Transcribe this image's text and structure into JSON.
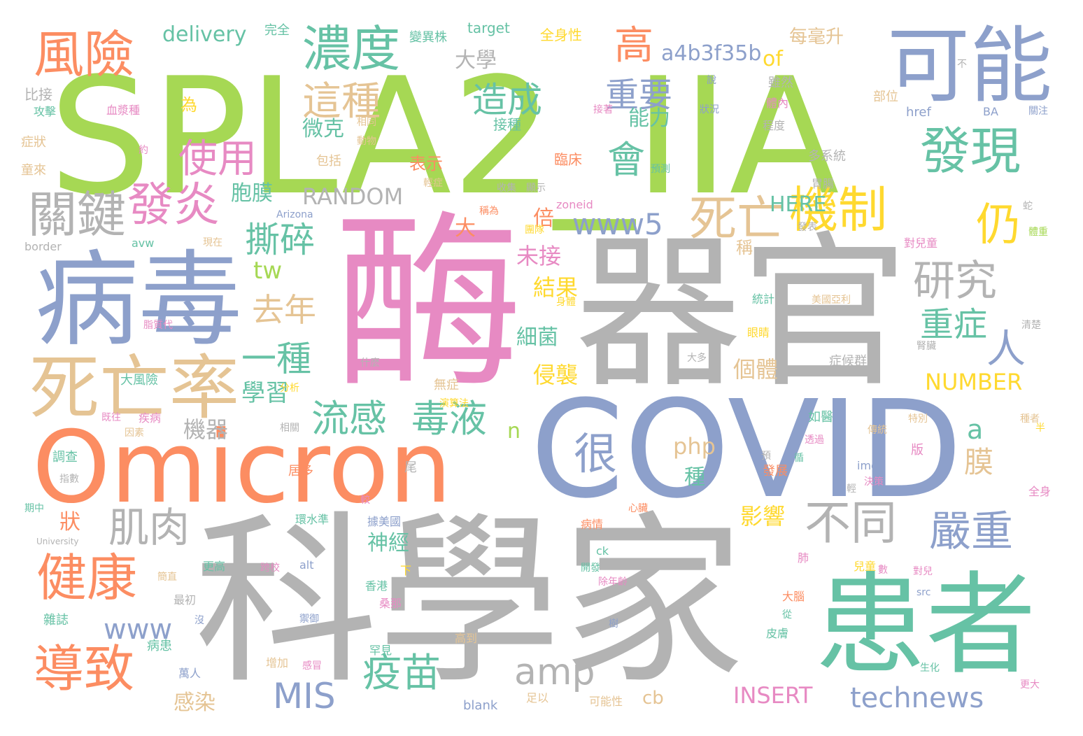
{
  "words": [
    {
      "text": "SPLA2_IIA",
      "color": "#a6d854"
    },
    {
      "text": "酶",
      "color": "#e78ac3"
    },
    {
      "text": "器官",
      "color": "#b3b3b3"
    },
    {
      "text": "COVID",
      "color": "#8da0cb"
    },
    {
      "text": "科學家",
      "color": "#b3b3b3"
    },
    {
      "text": "Omicron",
      "color": "#fc8d62"
    },
    {
      "text": "病毒",
      "color": "#8da0cb"
    },
    {
      "text": "患者",
      "color": "#66c2a5"
    },
    {
      "text": "死亡率",
      "color": "#e5c494"
    },
    {
      "text": "可能",
      "color": "#8da0cb"
    },
    {
      "text": "風險",
      "color": "#fc8d62"
    },
    {
      "text": "濃度",
      "color": "#66c2a5"
    },
    {
      "text": "發現",
      "color": "#66c2a5"
    },
    {
      "text": "關鍵",
      "color": "#b3b3b3"
    },
    {
      "text": "發炎",
      "color": "#e78ac3"
    },
    {
      "text": "死亡",
      "color": "#e5c494"
    },
    {
      "text": "機制",
      "color": "#ffd92f"
    },
    {
      "text": "仍",
      "color": "#ffd92f"
    },
    {
      "text": "健康",
      "color": "#fc8d62"
    },
    {
      "text": "導致",
      "color": "#fc8d62"
    },
    {
      "text": "嚴重",
      "color": "#8da0cb"
    },
    {
      "text": "不同",
      "color": "#b3b3b3"
    },
    {
      "text": "很",
      "color": "#8da0cb"
    },
    {
      "text": "研究",
      "color": "#b3b3b3"
    },
    {
      "text": "人",
      "color": "#8da0cb"
    },
    {
      "text": "會",
      "color": "#66c2a5"
    },
    {
      "text": "這種",
      "color": "#e5c494"
    },
    {
      "text": "使用",
      "color": "#e78ac3"
    },
    {
      "text": "高",
      "color": "#fc8d62"
    },
    {
      "text": "造成",
      "color": "#66c2a5"
    },
    {
      "text": "重要",
      "color": "#8da0cb"
    },
    {
      "text": "重症",
      "color": "#66c2a5"
    },
    {
      "text": "www5",
      "color": "#8da0cb"
    },
    {
      "text": "肌肉",
      "color": "#b3b3b3"
    },
    {
      "text": "撕碎",
      "color": "#66c2a5"
    },
    {
      "text": "流感",
      "color": "#66c2a5"
    },
    {
      "text": "毒液",
      "color": "#66c2a5"
    },
    {
      "text": "疫苗",
      "color": "#66c2a5"
    },
    {
      "text": "一種",
      "color": "#66c2a5"
    },
    {
      "text": "去年",
      "color": "#e5c494"
    },
    {
      "text": "amp",
      "color": "#b3b3b3"
    },
    {
      "text": "technews",
      "color": "#8da0cb"
    },
    {
      "text": "www",
      "color": "#8da0cb"
    },
    {
      "text": "MIS",
      "color": "#8da0cb"
    },
    {
      "text": "a4b3f35b",
      "color": "#8da0cb"
    },
    {
      "text": "delivery",
      "color": "#66c2a5"
    },
    {
      "text": "RANDOM",
      "color": "#b3b3b3"
    },
    {
      "text": "NUMBER",
      "color": "#ffd92f"
    },
    {
      "text": "INSERT",
      "color": "#e78ac3"
    },
    {
      "text": "HERE",
      "color": "#66c2a5"
    },
    {
      "text": "tw",
      "color": "#a6d854"
    },
    {
      "text": "php",
      "color": "#e5c494"
    },
    {
      "text": "a",
      "color": "#66c2a5"
    },
    {
      "text": "膜",
      "color": "#e5c494"
    },
    {
      "text": "大學",
      "color": "#b3b3b3"
    },
    {
      "text": "微克",
      "color": "#66c2a5"
    },
    {
      "text": "能力",
      "color": "#66c2a5"
    },
    {
      "text": "學習",
      "color": "#66c2a5"
    },
    {
      "text": "機器",
      "color": "#b3b3b3"
    },
    {
      "text": "胞膜",
      "color": "#66c2a5"
    },
    {
      "text": "未接",
      "color": "#e78ac3"
    },
    {
      "text": "結果",
      "color": "#ffd92f"
    },
    {
      "text": "倍",
      "color": "#fc8d62"
    },
    {
      "text": "大",
      "color": "#fc8d62"
    },
    {
      "text": "細菌",
      "color": "#66c2a5"
    },
    {
      "text": "侵襲",
      "color": "#ffd92f"
    },
    {
      "text": "個體",
      "color": "#e5c494"
    },
    {
      "text": "影響",
      "color": "#ffd92f"
    },
    {
      "text": "神經",
      "color": "#66c2a5"
    },
    {
      "text": "感染",
      "color": "#e5c494"
    },
    {
      "text": "種",
      "color": "#66c2a5"
    },
    {
      "text": "狀",
      "color": "#fc8d62"
    },
    {
      "text": "cb",
      "color": "#e5c494"
    },
    {
      "text": "of",
      "color": "#ffd92f"
    },
    {
      "text": "n",
      "color": "#a6d854"
    },
    {
      "text": "每毫升",
      "color": "#e5c494"
    },
    {
      "text": "為",
      "color": "#ffd92f"
    },
    {
      "text": "表示",
      "color": "#fc8d62"
    },
    {
      "text": "稱",
      "color": "#e5c494"
    },
    {
      "text": "接種",
      "color": "#66c2a5"
    },
    {
      "text": "包括",
      "color": "#e5c494"
    },
    {
      "text": "臨床",
      "color": "#fc8d62"
    },
    {
      "text": "全身性",
      "color": "#ffd92f"
    },
    {
      "text": "變異株",
      "color": "#66c2a5"
    },
    {
      "text": "target",
      "color": "#66c2a5"
    },
    {
      "text": "完全",
      "color": "#66c2a5"
    },
    {
      "text": "雖然",
      "color": "#b3b3b3"
    },
    {
      "text": "體內",
      "color": "#e78ac3"
    },
    {
      "text": "程度",
      "color": "#b3b3b3"
    },
    {
      "text": "多系統",
      "color": "#b3b3b3"
    },
    {
      "text": "胃腸",
      "color": "#b3b3b3"
    },
    {
      "text": "部位",
      "color": "#e5c494"
    },
    {
      "text": "href",
      "color": "#8da0cb"
    },
    {
      "text": "BA",
      "color": "#8da0cb"
    },
    {
      "text": "zoneid",
      "color": "#e78ac3"
    },
    {
      "text": "輕症",
      "color": "#e5c494"
    },
    {
      "text": "說",
      "color": "#8da0cb"
    },
    {
      "text": "狀況",
      "color": "#8da0cb"
    },
    {
      "text": "不",
      "color": "#b3b3b3"
    },
    {
      "text": "比接",
      "color": "#b3b3b3"
    },
    {
      "text": "攻擊",
      "color": "#66c2a5"
    },
    {
      "text": "血漿種",
      "color": "#e78ac3"
    },
    {
      "text": "症狀",
      "color": "#e5c494"
    },
    {
      "text": "童來",
      "color": "#e5c494"
    },
    {
      "text": "約",
      "color": "#e78ac3"
    },
    {
      "text": "接著",
      "color": "#e78ac3"
    },
    {
      "text": "相同",
      "color": "#e5c494"
    },
    {
      "text": "動物",
      "color": "#e5c494"
    },
    {
      "text": "預測",
      "color": "#66c2a5"
    },
    {
      "text": "收集",
      "color": "#b3b3b3"
    },
    {
      "text": "顯示",
      "color": "#b3b3b3"
    },
    {
      "text": "團隊",
      "color": "#ffd92f"
    },
    {
      "text": "稱為",
      "color": "#fc8d62"
    },
    {
      "text": "Arizona",
      "color": "#8da0cb"
    },
    {
      "text": "border",
      "color": "#b3b3b3"
    },
    {
      "text": "avw",
      "color": "#66c2a5"
    },
    {
      "text": "現在",
      "color": "#e5c494"
    },
    {
      "text": "發表",
      "color": "#b3b3b3"
    },
    {
      "text": "對兒童",
      "color": "#e78ac3"
    },
    {
      "text": "體重",
      "color": "#a6d854"
    },
    {
      "text": "關注",
      "color": "#8da0cb"
    },
    {
      "text": "蛇",
      "color": "#b3b3b3"
    },
    {
      "text": "身體",
      "color": "#ffd92f"
    },
    {
      "text": "統計",
      "color": "#66c2a5"
    },
    {
      "text": "美國亞利",
      "color": "#e5c494"
    },
    {
      "text": "眼睛",
      "color": "#ffd92f"
    },
    {
      "text": "症候群",
      "color": "#b3b3b3"
    },
    {
      "text": "腎臟",
      "color": "#b3b3b3"
    },
    {
      "text": "清楚",
      "color": "#b3b3b3"
    },
    {
      "text": "脂質代",
      "color": "#e78ac3"
    },
    {
      "text": "什麼",
      "color": "#b3b3b3"
    },
    {
      "text": "大多",
      "color": "#b3b3b3"
    },
    {
      "text": "大風險",
      "color": "#66c2a5"
    },
    {
      "text": "無症",
      "color": "#e5c494"
    },
    {
      "text": "分析",
      "color": "#ffd92f"
    },
    {
      "text": "演算法",
      "color": "#ffd92f"
    },
    {
      "text": "既往",
      "color": "#e78ac3"
    },
    {
      "text": "疾病",
      "color": "#e78ac3"
    },
    {
      "text": "因素",
      "color": "#e5c494"
    },
    {
      "text": "相關",
      "color": "#b3b3b3"
    },
    {
      "text": "如醫",
      "color": "#66c2a5"
    },
    {
      "text": "特別",
      "color": "#e5c494"
    },
    {
      "text": "種者",
      "color": "#e5c494"
    },
    {
      "text": "半",
      "color": "#ffd92f"
    },
    {
      "text": "調查",
      "color": "#66c2a5"
    },
    {
      "text": "指數",
      "color": "#b3b3b3"
    },
    {
      "text": "居多",
      "color": "#fc8d62"
    },
    {
      "text": "尾",
      "color": "#b3b3b3"
    },
    {
      "text": "透過",
      "color": "#e78ac3"
    },
    {
      "text": "傳統",
      "color": "#e5c494"
    },
    {
      "text": "版",
      "color": "#e78ac3"
    },
    {
      "text": "img",
      "color": "#8da0cb"
    },
    {
      "text": "預",
      "color": "#b3b3b3"
    },
    {
      "text": "循",
      "color": "#66c2a5"
    },
    {
      "text": "決策",
      "color": "#e78ac3"
    },
    {
      "text": "發展",
      "color": "#fc8d62"
    },
    {
      "text": "輕",
      "color": "#b3b3b3"
    },
    {
      "text": "期中",
      "color": "#66c2a5"
    },
    {
      "text": "較",
      "color": "#e78ac3"
    },
    {
      "text": "環水準",
      "color": "#66c2a5"
    },
    {
      "text": "心臟",
      "color": "#fc8d62"
    },
    {
      "text": "全身",
      "color": "#e78ac3"
    },
    {
      "text": "University",
      "color": "#b3b3b3"
    },
    {
      "text": "據美國",
      "color": "#8da0cb"
    },
    {
      "text": "病情",
      "color": "#fc8d62"
    },
    {
      "text": "更高",
      "color": "#66c2a5"
    },
    {
      "text": "跨校",
      "color": "#e78ac3"
    },
    {
      "text": "ck",
      "color": "#66c2a5"
    },
    {
      "text": "開發",
      "color": "#66c2a5"
    },
    {
      "text": "除年齡",
      "color": "#e78ac3"
    },
    {
      "text": "肺",
      "color": "#e78ac3"
    },
    {
      "text": "兒童",
      "color": "#ffd92f"
    },
    {
      "text": "數",
      "color": "#e78ac3"
    },
    {
      "text": "對兒",
      "color": "#e78ac3"
    },
    {
      "text": "alt",
      "color": "#8da0cb"
    },
    {
      "text": "下",
      "color": "#ffd92f"
    },
    {
      "text": "香港",
      "color": "#66c2a5"
    },
    {
      "text": "桑那",
      "color": "#e78ac3"
    },
    {
      "text": "大腦",
      "color": "#fc8d62"
    },
    {
      "text": "src",
      "color": "#8da0cb"
    },
    {
      "text": "從",
      "color": "#66c2a5"
    },
    {
      "text": "皮膚",
      "color": "#66c2a5"
    },
    {
      "text": "樹",
      "color": "#8da0cb"
    },
    {
      "text": "簡直",
      "color": "#e5c494"
    },
    {
      "text": "最初",
      "color": "#b3b3b3"
    },
    {
      "text": "雜誌",
      "color": "#66c2a5"
    },
    {
      "text": "沒",
      "color": "#8da0cb"
    },
    {
      "text": "病患",
      "color": "#66c2a5"
    },
    {
      "text": "禦御",
      "color": "#8da0cb"
    },
    {
      "text": "罕見",
      "color": "#66c2a5"
    },
    {
      "text": "高到",
      "color": "#e5c494"
    },
    {
      "text": "增加",
      "color": "#e5c494"
    },
    {
      "text": "感冒",
      "color": "#e78ac3"
    },
    {
      "text": "萬人",
      "color": "#8da0cb"
    },
    {
      "text": "生化",
      "color": "#66c2a5"
    },
    {
      "text": "更大",
      "color": "#e78ac3"
    },
    {
      "text": "blank",
      "color": "#8da0cb"
    },
    {
      "text": "足以",
      "color": "#e5c494"
    },
    {
      "text": "可能性",
      "color": "#e5c494"
    }
  ]
}
